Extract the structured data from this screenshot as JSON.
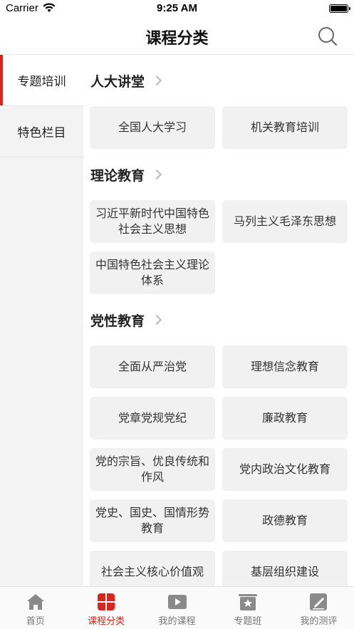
{
  "status": {
    "carrier": "Carrier",
    "time": "9:25 AM"
  },
  "nav": {
    "title": "课程分类"
  },
  "sidebar": {
    "items": [
      {
        "label": "专题培训"
      },
      {
        "label": "特色栏目"
      }
    ]
  },
  "sections": [
    {
      "title": "人大讲堂",
      "tiles": [
        "全国人大学习",
        "机关教育培训"
      ]
    },
    {
      "title": "理论教育",
      "tiles": [
        "习近平新时代中国特色社会主义思想",
        "马列主义毛泽东思想",
        "中国特色社会主义理论体系"
      ]
    },
    {
      "title": "党性教育",
      "tiles": [
        "全面从严治党",
        "理想信念教育",
        "党章党规党纪",
        "廉政教育",
        "党的宗旨、优良传统和作风",
        "党内政治文化教育",
        "党史、国史、国情形势教育",
        "政德教育",
        "社会主义核心价值观",
        "基层组织建设"
      ]
    }
  ],
  "tabbar": {
    "items": [
      {
        "label": "首页",
        "icon": "home-icon"
      },
      {
        "label": "课程分类",
        "icon": "category-grid-icon"
      },
      {
        "label": "我的课程",
        "icon": "play-video-icon"
      },
      {
        "label": "专题班",
        "icon": "star-board-icon"
      },
      {
        "label": "我的测评",
        "icon": "edit-note-icon"
      }
    ]
  },
  "colors": {
    "accent": "#d9251b",
    "tile_bg": "#f1f1f1",
    "sidebar_bg": "#f3f3f3",
    "icon_gray": "#888888"
  }
}
